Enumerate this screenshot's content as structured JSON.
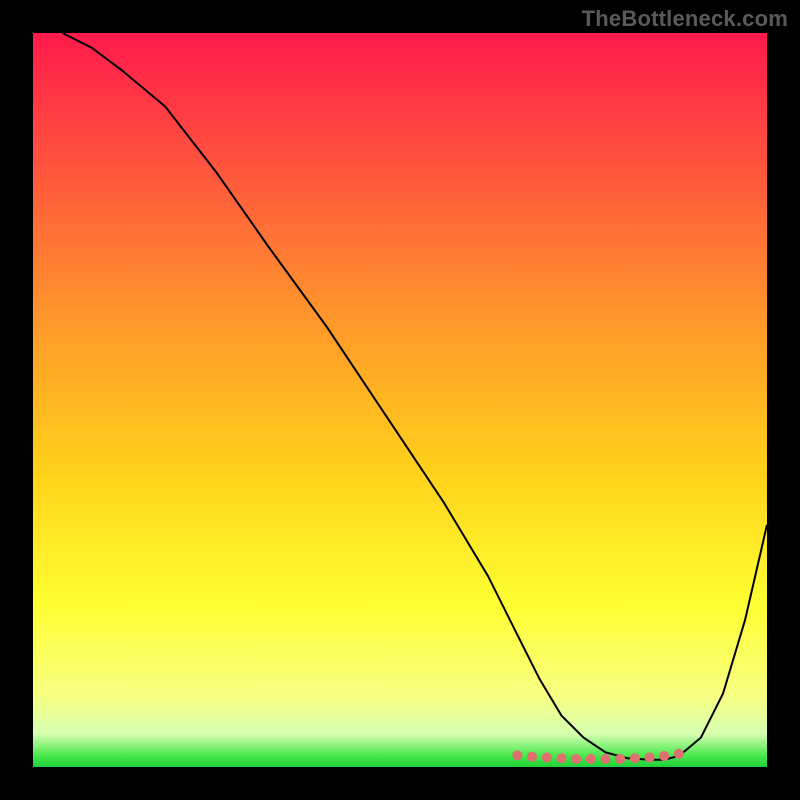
{
  "watermark": {
    "text": "TheBottleneck.com"
  },
  "chart_data": {
    "type": "line",
    "title": "",
    "xlabel": "",
    "ylabel": "",
    "xlim": [
      0,
      100
    ],
    "ylim": [
      0,
      100
    ],
    "grid": false,
    "legend": false,
    "background_gradient": {
      "stops": [
        {
          "offset": 0.0,
          "color": "#ff1a4b"
        },
        {
          "offset": 0.2,
          "color": "#ff5a3c"
        },
        {
          "offset": 0.4,
          "color": "#ff9a2a"
        },
        {
          "offset": 0.6,
          "color": "#ffd21a"
        },
        {
          "offset": 0.78,
          "color": "#ffff33"
        },
        {
          "offset": 0.9,
          "color": "#f8ff80"
        },
        {
          "offset": 0.955,
          "color": "#d6ffb0"
        },
        {
          "offset": 0.985,
          "color": "#45e84a"
        },
        {
          "offset": 1.0,
          "color": "#1fd13a"
        }
      ]
    },
    "series": [
      {
        "name": "curve",
        "color": "#000000",
        "width": 2,
        "x": [
          4,
          8,
          12,
          18,
          25,
          32,
          40,
          48,
          56,
          62,
          66,
          69,
          72,
          75,
          78,
          81,
          84,
          86,
          88,
          91,
          94,
          97,
          100
        ],
        "y": [
          100,
          98,
          95,
          90,
          81,
          71,
          60,
          48,
          36,
          26,
          18,
          12,
          7,
          4,
          2,
          1.2,
          1,
          1,
          1.5,
          4,
          10,
          20,
          33
        ]
      },
      {
        "name": "flat-dots",
        "type": "scatter",
        "color": "#e07070",
        "radius": 5,
        "x": [
          66,
          68,
          70,
          72,
          74,
          76,
          78,
          80,
          82,
          84,
          86,
          88
        ],
        "y": [
          1.6,
          1.4,
          1.3,
          1.2,
          1.1,
          1.1,
          1.1,
          1.1,
          1.2,
          1.3,
          1.5,
          1.8
        ]
      }
    ]
  }
}
